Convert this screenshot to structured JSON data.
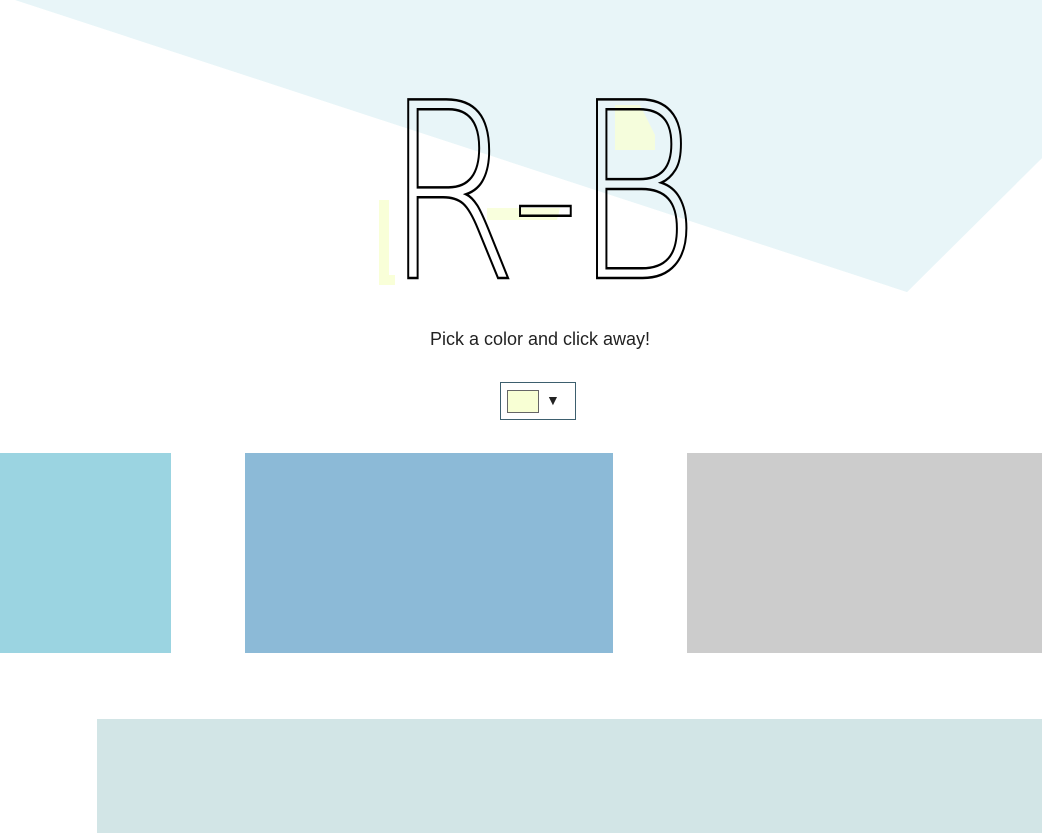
{
  "logo": {
    "text": "R-B"
  },
  "tagline": "Pick a color and click away!",
  "picker": {
    "selected_color": "#f8ffd4",
    "arrow": "▼"
  },
  "colors": {
    "background_shape": "#e8f5f8",
    "block_1": "#9bd4e1",
    "block_2": "#8cbad7",
    "block_3": "#cccccc",
    "bottom_panel": "#d2e5e6",
    "highlight": "#f8ffd4"
  }
}
